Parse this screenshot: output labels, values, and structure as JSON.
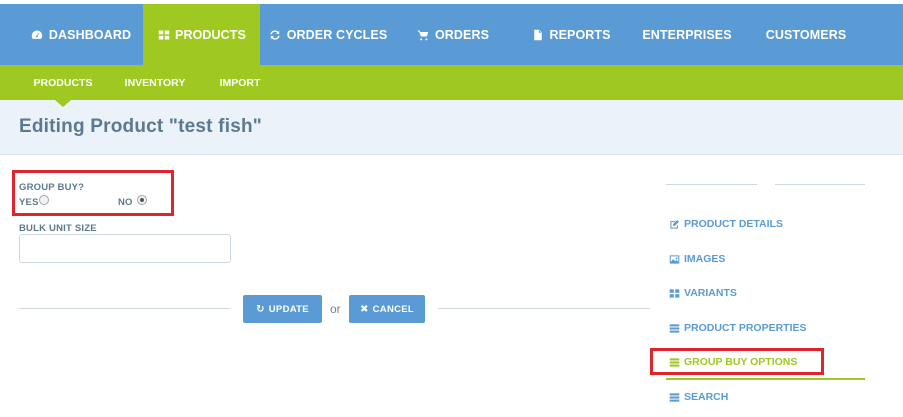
{
  "topnav": {
    "items": [
      {
        "label": "DASHBOARD",
        "icon": "dashboard-icon",
        "active": false
      },
      {
        "label": "PRODUCTS",
        "icon": "grid-icon",
        "active": true
      },
      {
        "label": "ORDER CYCLES",
        "icon": "refresh-icon",
        "active": false
      },
      {
        "label": "ORDERS",
        "icon": "cart-icon",
        "active": false
      },
      {
        "label": "REPORTS",
        "icon": "file-icon",
        "active": false
      },
      {
        "label": "ENTERPRISES",
        "icon": "",
        "active": false
      },
      {
        "label": "CUSTOMERS",
        "icon": "",
        "active": false
      }
    ]
  },
  "subnav": {
    "items": [
      {
        "label": "PRODUCTS",
        "active": true
      },
      {
        "label": "INVENTORY",
        "active": false
      },
      {
        "label": "IMPORT",
        "active": false
      }
    ]
  },
  "page": {
    "title": "Editing Product \"test fish\""
  },
  "form": {
    "group_buy_label": "GROUP BUY?",
    "yes_label": "YES",
    "no_label": "NO",
    "group_buy_value": "NO",
    "bulk_unit_label": "BULK UNIT SIZE",
    "bulk_unit_value": "",
    "update_label": "UPDATE",
    "or_label": "or",
    "cancel_label": "CANCEL"
  },
  "sidebar": {
    "items": [
      {
        "label": "PRODUCT DETAILS",
        "icon": "edit-icon",
        "active": false
      },
      {
        "label": "IMAGES",
        "icon": "picture-icon",
        "active": false
      },
      {
        "label": "VARIANTS",
        "icon": "grid-icon",
        "active": false
      },
      {
        "label": "PRODUCT PROPERTIES",
        "icon": "list-icon",
        "active": false
      },
      {
        "label": "GROUP BUY OPTIONS",
        "icon": "list-icon",
        "active": true
      },
      {
        "label": "SEARCH",
        "icon": "list-icon",
        "active": false
      }
    ]
  },
  "colors": {
    "primary_blue": "#5b9bd5",
    "accent_green": "#9fc820",
    "highlight_red": "#e0242b",
    "title_band": "#ebf2f9"
  }
}
